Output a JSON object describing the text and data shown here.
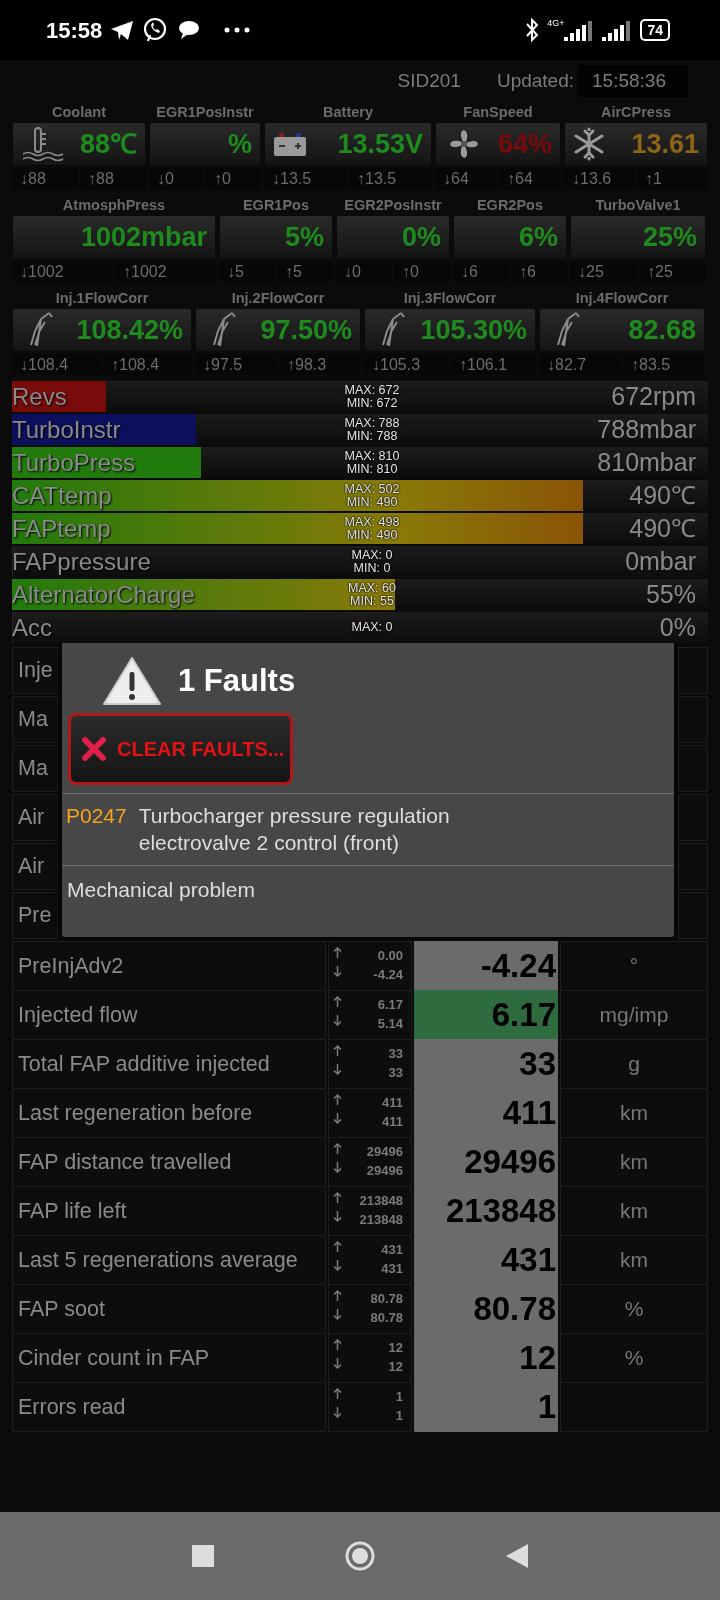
{
  "status_bar": {
    "time": "15:58",
    "network": "4G+",
    "battery": "74"
  },
  "header": {
    "device": "SID201",
    "updated_label": "Updated:",
    "updated_time": "15:58:36"
  },
  "gauge_rows": [
    {
      "gauges": [
        {
          "label": "Coolant",
          "kind": "thermometer",
          "value": "88℃",
          "color": "#1d8c1d",
          "min": "↓88",
          "max": "↑88"
        },
        {
          "label": "EGR1PosInstr",
          "kind": "none",
          "value": "%",
          "color": "#1d8c1d",
          "min": "↓0",
          "max": "↑0"
        },
        {
          "label": "Battery",
          "kind": "battery",
          "value": "13.53V",
          "color": "#1d8c1d",
          "min": "↓13.5",
          "max": "↑13.5"
        },
        {
          "label": "FanSpeed",
          "kind": "fan",
          "value": "64%",
          "color": "#7a0a0a",
          "min": "↓64",
          "max": "↑64"
        },
        {
          "label": "AirCPress",
          "kind": "snowflake",
          "value": "13.61",
          "color": "#8c6414",
          "min": "↓13.6",
          "max": "↑1"
        }
      ]
    },
    {
      "gauges": [
        {
          "label": "AtmosphPress",
          "kind": "none",
          "value": "1002mbar",
          "color": "#1d8c1d",
          "min": "↓1002",
          "max": "↑1002"
        },
        {
          "label": "EGR1Pos",
          "kind": "none",
          "value": "5%",
          "color": "#1d8c1d",
          "min": "↓5",
          "max": "↑5"
        },
        {
          "label": "EGR2PosInstr",
          "kind": "none",
          "value": "0%",
          "color": "#1d8c1d",
          "min": "↓0",
          "max": "↑0"
        },
        {
          "label": "EGR2Pos",
          "kind": "none",
          "value": "6%",
          "color": "#1d8c1d",
          "min": "↓6",
          "max": "↑6"
        },
        {
          "label": "TurboValve1",
          "kind": "none",
          "value": "25%",
          "color": "#1d8c1d",
          "min": "↓25",
          "max": "↑25"
        }
      ]
    },
    {
      "gauges": [
        {
          "label": "Inj.1FlowCorr",
          "kind": "injector",
          "value": "108.42%",
          "color": "#1d8c1d",
          "min": "↓108.4",
          "max": "↑108.4"
        },
        {
          "label": "Inj.2FlowCorr",
          "kind": "injector",
          "value": "97.50%",
          "color": "#1d8c1d",
          "min": "↓97.5",
          "max": "↑98.3"
        },
        {
          "label": "Inj.3FlowCorr",
          "kind": "injector",
          "value": "105.30%",
          "color": "#1d8c1d",
          "min": "↓105.3",
          "max": "↑106.1"
        },
        {
          "label": "Inj.4FlowCorr",
          "kind": "injector",
          "value": "82.68",
          "color": "#1d8c1d",
          "min": "↓82.7",
          "max": "↑83.5"
        }
      ]
    }
  ],
  "bars": [
    {
      "label": "Revs",
      "max": "MAX: 672",
      "min": "MIN: 672",
      "value": "672rpm",
      "level": 0.135,
      "kind": "solid",
      "color": "#7a0b0b"
    },
    {
      "label": "TurboInstr",
      "max": "MAX: 788",
      "min": "MIN: 788",
      "value": "788mbar",
      "level": 0.265,
      "kind": "solid",
      "color": "#0b0f5c"
    },
    {
      "label": "TurboPress",
      "max": "MAX: 810",
      "min": "MIN: 810",
      "value": "810mbar",
      "level": 0.272,
      "kind": "solid",
      "color": "#217a0c"
    },
    {
      "label": "CATtemp",
      "max": "MAX: 502",
      "min": "MIN: 490",
      "value": "490℃",
      "level": 0.82,
      "kind": "gradient",
      "color": "#217a0c"
    },
    {
      "label": "FAPtemp",
      "max": "MAX: 498",
      "min": "MIN: 490",
      "value": "490℃",
      "level": 0.82,
      "kind": "gradient",
      "color": "#217a0c"
    },
    {
      "label": "FAPpressure",
      "max": "MAX: 0",
      "min": "MIN: 0",
      "value": "0mbar",
      "level": 0,
      "kind": "solid"
    },
    {
      "label": "AlternatorCharge",
      "max": "MAX: 60",
      "min": "MIN: 55",
      "value": "55%",
      "level": 0.55,
      "kind": "gradient",
      "color": "#217a0c"
    },
    {
      "label": "Acc",
      "max": "MAX: 0",
      "value": "0%",
      "level": 0,
      "kind": "solid"
    }
  ],
  "table": {
    "rows": [
      {
        "label": "Inje"
      },
      {
        "label": "Ma"
      },
      {
        "label": "Ma"
      },
      {
        "label": "Air"
      },
      {
        "label": "Air"
      },
      {
        "label": "Pre"
      },
      {
        "label": "PreInjAdv2",
        "max": "0.00",
        "min": "-4.24",
        "value": "-4.24",
        "unit": "°",
        "highlighted": false
      },
      {
        "label": "Injected flow",
        "max": "6.17",
        "min": "5.14",
        "value": "6.17",
        "unit": "mg/imp",
        "highlighted": true
      },
      {
        "label": "Total FAP additive injected",
        "max": "33",
        "min": "33",
        "value": "33",
        "unit": "g",
        "highlighted": false
      },
      {
        "label": "Last regeneration before",
        "max": "411",
        "min": "411",
        "value": "411",
        "unit": "km",
        "highlighted": false
      },
      {
        "label": "FAP distance travelled",
        "max": "29496",
        "min": "29496",
        "value": "29496",
        "unit": "km",
        "highlighted": false
      },
      {
        "label": "FAP life left",
        "max": "213848",
        "min": "213848",
        "value": "213848",
        "unit": "km",
        "highlighted": false
      },
      {
        "label": "Last 5 regenerations average",
        "max": "431",
        "min": "431",
        "value": "431",
        "unit": "km",
        "highlighted": false
      },
      {
        "label": "FAP soot",
        "max": "80.78",
        "min": "80.78",
        "value": "80.78",
        "unit": "%",
        "highlighted": false
      },
      {
        "label": "Cinder count in FAP",
        "max": "12",
        "min": "12",
        "value": "12",
        "unit": "%",
        "highlighted": false
      },
      {
        "label": "Errors read",
        "max": "1",
        "min": "1",
        "value": "1",
        "highlighted": false
      }
    ]
  },
  "dialog": {
    "title": "1 Faults",
    "clear_button": "CLEAR FAULTS...",
    "faults": [
      {
        "code": "P0247",
        "description": "Turbocharger pressure regulation electrovalve 2 control (front)"
      }
    ],
    "detail": "Mechanical problem"
  }
}
